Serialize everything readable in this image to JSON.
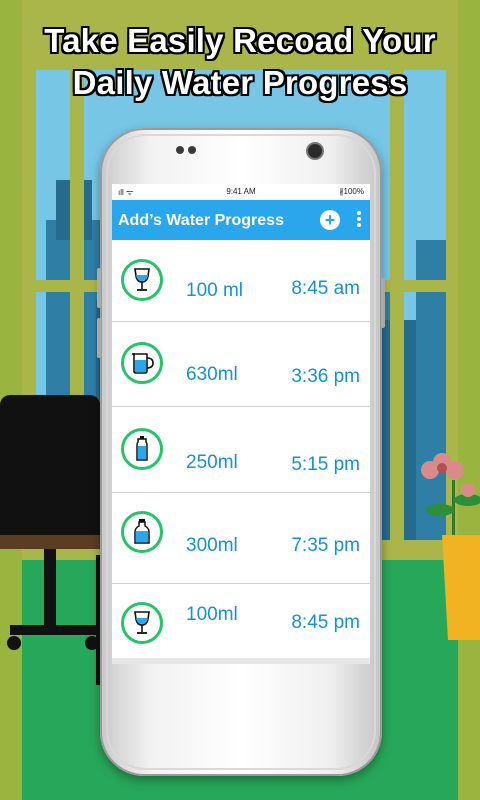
{
  "headline": {
    "line1": "Take Easily Recoad Your",
    "line2": "Daily Water Progress"
  },
  "statusbar": {
    "signal": "ıll ᯤ",
    "time": "9:41 AM",
    "battery": "∦100%"
  },
  "appbar": {
    "title": "Add’s Water Progress",
    "add_label": "+",
    "add_icon": "add-circle-icon",
    "more_icon": "more-vertical-icon"
  },
  "entries": [
    {
      "icon": "wine-glass-icon",
      "amount": "100 ml",
      "time": "8:45 am"
    },
    {
      "icon": "jug-icon",
      "amount": "630ml",
      "time": "3:36 pm"
    },
    {
      "icon": "sports-bottle-icon",
      "amount": "250ml",
      "time": "5:15 pm"
    },
    {
      "icon": "milk-bottle-icon",
      "amount": "300ml",
      "time": "7:35 pm"
    },
    {
      "icon": "wine-glass-icon",
      "amount": "100ml",
      "time": "8:45 pm"
    }
  ],
  "colors": {
    "appbar": "#2aa6ec",
    "text_accent": "#1592d6",
    "icon_ring": "#27c36a",
    "water": "#2aa6ec"
  }
}
